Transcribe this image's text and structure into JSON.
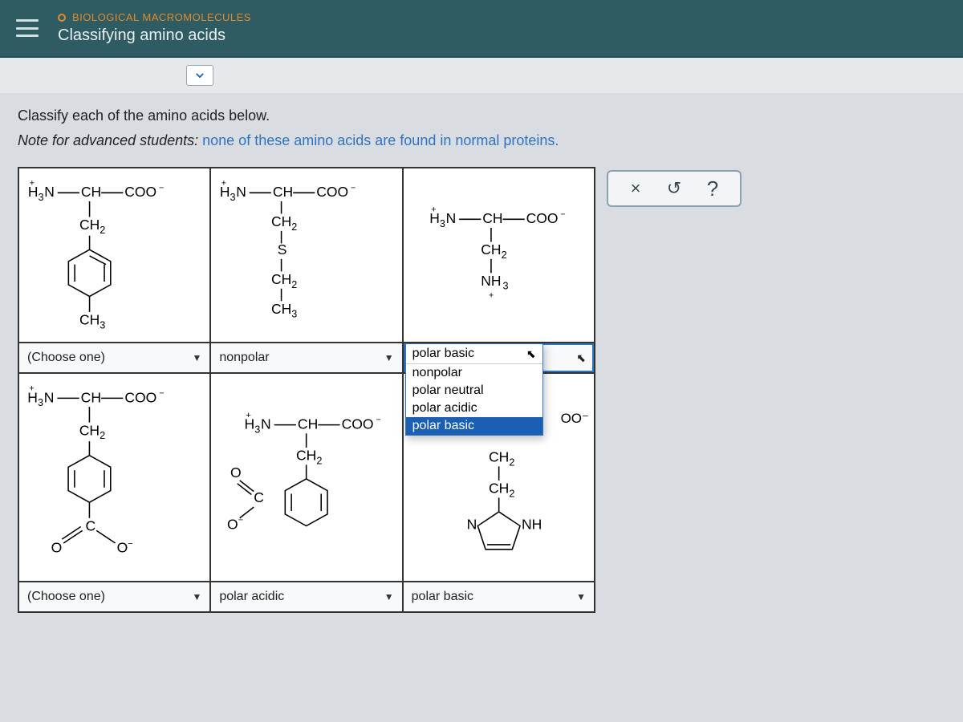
{
  "header": {
    "breadcrumb": "BIOLOGICAL MACROMOLECULES",
    "title": "Classifying amino acids"
  },
  "prompt": "Classify each of the amino acids below.",
  "note_lead": "Note for advanced students:",
  "note_rest": " none of these amino acids are found in normal proteins.",
  "selectors": {
    "s1": {
      "label": "(Choose one)",
      "state": "closed"
    },
    "s2": {
      "label": "nonpolar",
      "state": "closed"
    },
    "s3": {
      "label": "polar basic",
      "state": "open"
    },
    "s4": {
      "label": "(Choose one)",
      "state": "closed"
    },
    "s5": {
      "label": "polar acidic",
      "state": "closed"
    },
    "s6": {
      "label": "polar basic",
      "state": "closed"
    }
  },
  "dropdown": {
    "current": "polar basic",
    "options": [
      "nonpolar",
      "polar neutral",
      "polar acidic",
      "polar basic"
    ],
    "selected": "polar basic"
  },
  "partial_text": "OO⁻",
  "tools": {
    "close": "×",
    "reset": "↺",
    "help": "?"
  },
  "chem": {
    "backbone": "H₃N—CH—COO⁻",
    "backbone_plus": "+",
    "ch2": "CH₂",
    "ch3": "CH₃",
    "s": "S",
    "nh3": "NH₃",
    "nh3_plus": "+",
    "o": "O",
    "o_minus": "O₋",
    "c": "C",
    "n": "N",
    "nh": "NH"
  }
}
